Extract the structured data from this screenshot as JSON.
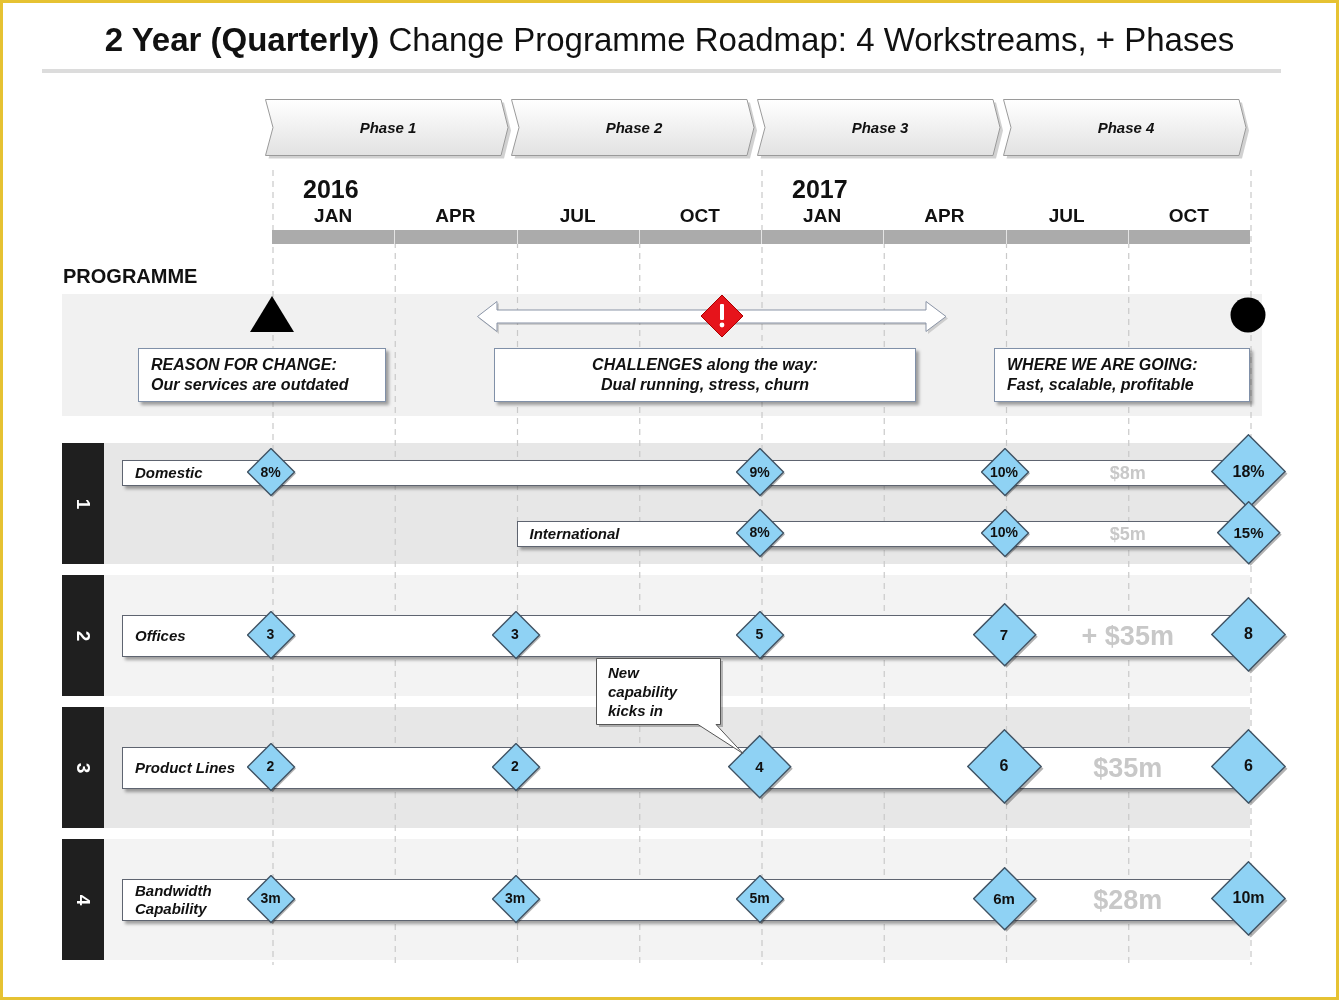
{
  "title": "**2 Year (Quarterly)** Change Programme Roadmap: 4 Workstreams, + Phases",
  "phases": [
    "Phase 1",
    "Phase 2",
    "Phase 3",
    "Phase 4"
  ],
  "timeline": {
    "years": [
      "2016",
      "2017"
    ],
    "quarters": [
      "JAN",
      "APR",
      "JUL",
      "OCT",
      "JAN",
      "APR",
      "JUL",
      "OCT"
    ]
  },
  "programme": {
    "label": "PROGRAMME",
    "items": [
      {
        "kind": "start",
        "title": "REASON FOR CHANGE:",
        "text": "Our services are outdated"
      },
      {
        "kind": "challenge",
        "title": "CHALLENGES along the way:",
        "text": "Dual running, stress, churn"
      },
      {
        "kind": "goal",
        "title": "WHERE WE ARE GOING:",
        "text": "Fast, scalable, profitable"
      }
    ]
  },
  "workstreams": [
    {
      "number": "1",
      "bars": [
        {
          "kind": "full",
          "label": "Domestic",
          "total": "$8m",
          "milestones": [
            {
              "kind": "small",
              "label": "8%"
            },
            {
              "kind": "gap"
            },
            {
              "kind": "small",
              "label": "9%"
            },
            {
              "kind": "small",
              "label": "10%"
            },
            {
              "kind": "large",
              "label": "18%"
            }
          ]
        },
        {
          "kind": "partial",
          "label": "International",
          "total": "$5m",
          "milestones": [
            {
              "kind": "gap"
            },
            {
              "kind": "gap"
            },
            {
              "kind": "small",
              "label": "8%"
            },
            {
              "kind": "small",
              "label": "10%"
            },
            {
              "kind": "medium",
              "label": "15%"
            }
          ]
        }
      ]
    },
    {
      "number": "2",
      "bars": [
        {
          "kind": "full",
          "label": "Offices",
          "total": "+ $35m",
          "milestones": [
            {
              "kind": "small",
              "label": "3"
            },
            {
              "kind": "small",
              "label": "3"
            },
            {
              "kind": "small",
              "label": "5"
            },
            {
              "kind": "medium",
              "label": "7"
            },
            {
              "kind": "large",
              "label": "8"
            }
          ]
        }
      ]
    },
    {
      "number": "3",
      "bars": [
        {
          "kind": "full",
          "label": "Product Lines",
          "total": "$35m",
          "milestones": [
            {
              "kind": "small",
              "label": "2"
            },
            {
              "kind": "small",
              "label": "2"
            },
            {
              "kind": "medium",
              "label": "4",
              "callout": "New capability kicks in"
            },
            {
              "kind": "large",
              "label": "6"
            },
            {
              "kind": "large",
              "label": "6"
            }
          ]
        }
      ]
    },
    {
      "number": "4",
      "bars": [
        {
          "kind": "full",
          "label": "Bandwidth Capability",
          "total": "$28m",
          "milestones": [
            {
              "kind": "small",
              "label": "3m"
            },
            {
              "kind": "small",
              "label": "3m"
            },
            {
              "kind": "small",
              "label": "5m"
            },
            {
              "kind": "medium",
              "label": "6m"
            },
            {
              "kind": "large",
              "label": "10m"
            }
          ]
        }
      ]
    }
  ]
}
